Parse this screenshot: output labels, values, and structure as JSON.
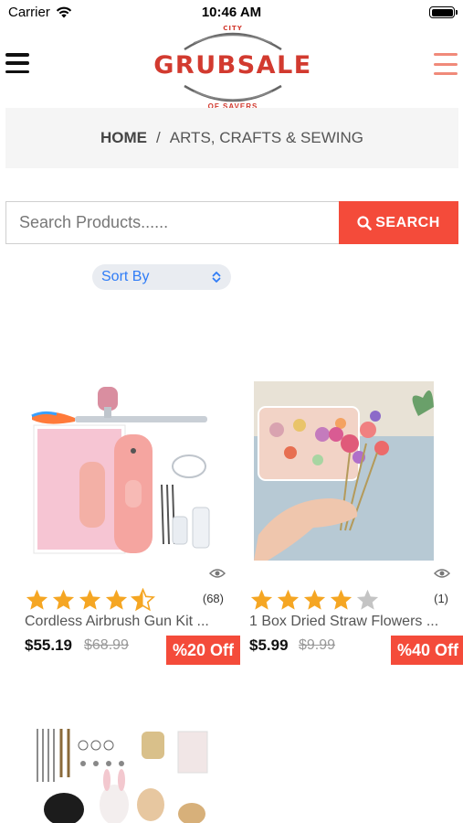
{
  "status_bar": {
    "carrier": "Carrier",
    "time": "10:46 AM"
  },
  "logo": {
    "top_text": "CITY",
    "name": "GRUBSALE",
    "sub": "OF SAVERS"
  },
  "breadcrumb": {
    "home": "HOME",
    "separator": "/",
    "current": "ARTS, CRAFTS & SEWING"
  },
  "search": {
    "placeholder": "Search Products......",
    "button_label": "SEARCH"
  },
  "sort": {
    "label": "Sort By"
  },
  "products": [
    {
      "name": "Cordless Airbrush Gun Kit ...",
      "price": "$55.19",
      "old_price": "$68.99",
      "discount": "%20 Off",
      "rating": 4.5,
      "review_count": "(68)"
    },
    {
      "name": "1 Box Dried Straw Flowers ...",
      "price": "$5.99",
      "old_price": "$9.99",
      "discount": "%40 Off",
      "rating": 4,
      "review_count": "(1)"
    }
  ],
  "colors": {
    "accent": "#f44b3a",
    "star": "#f5a623",
    "star_empty": "#c4c4c4",
    "brand": "#d23a2f",
    "link": "#2f7cf6"
  }
}
